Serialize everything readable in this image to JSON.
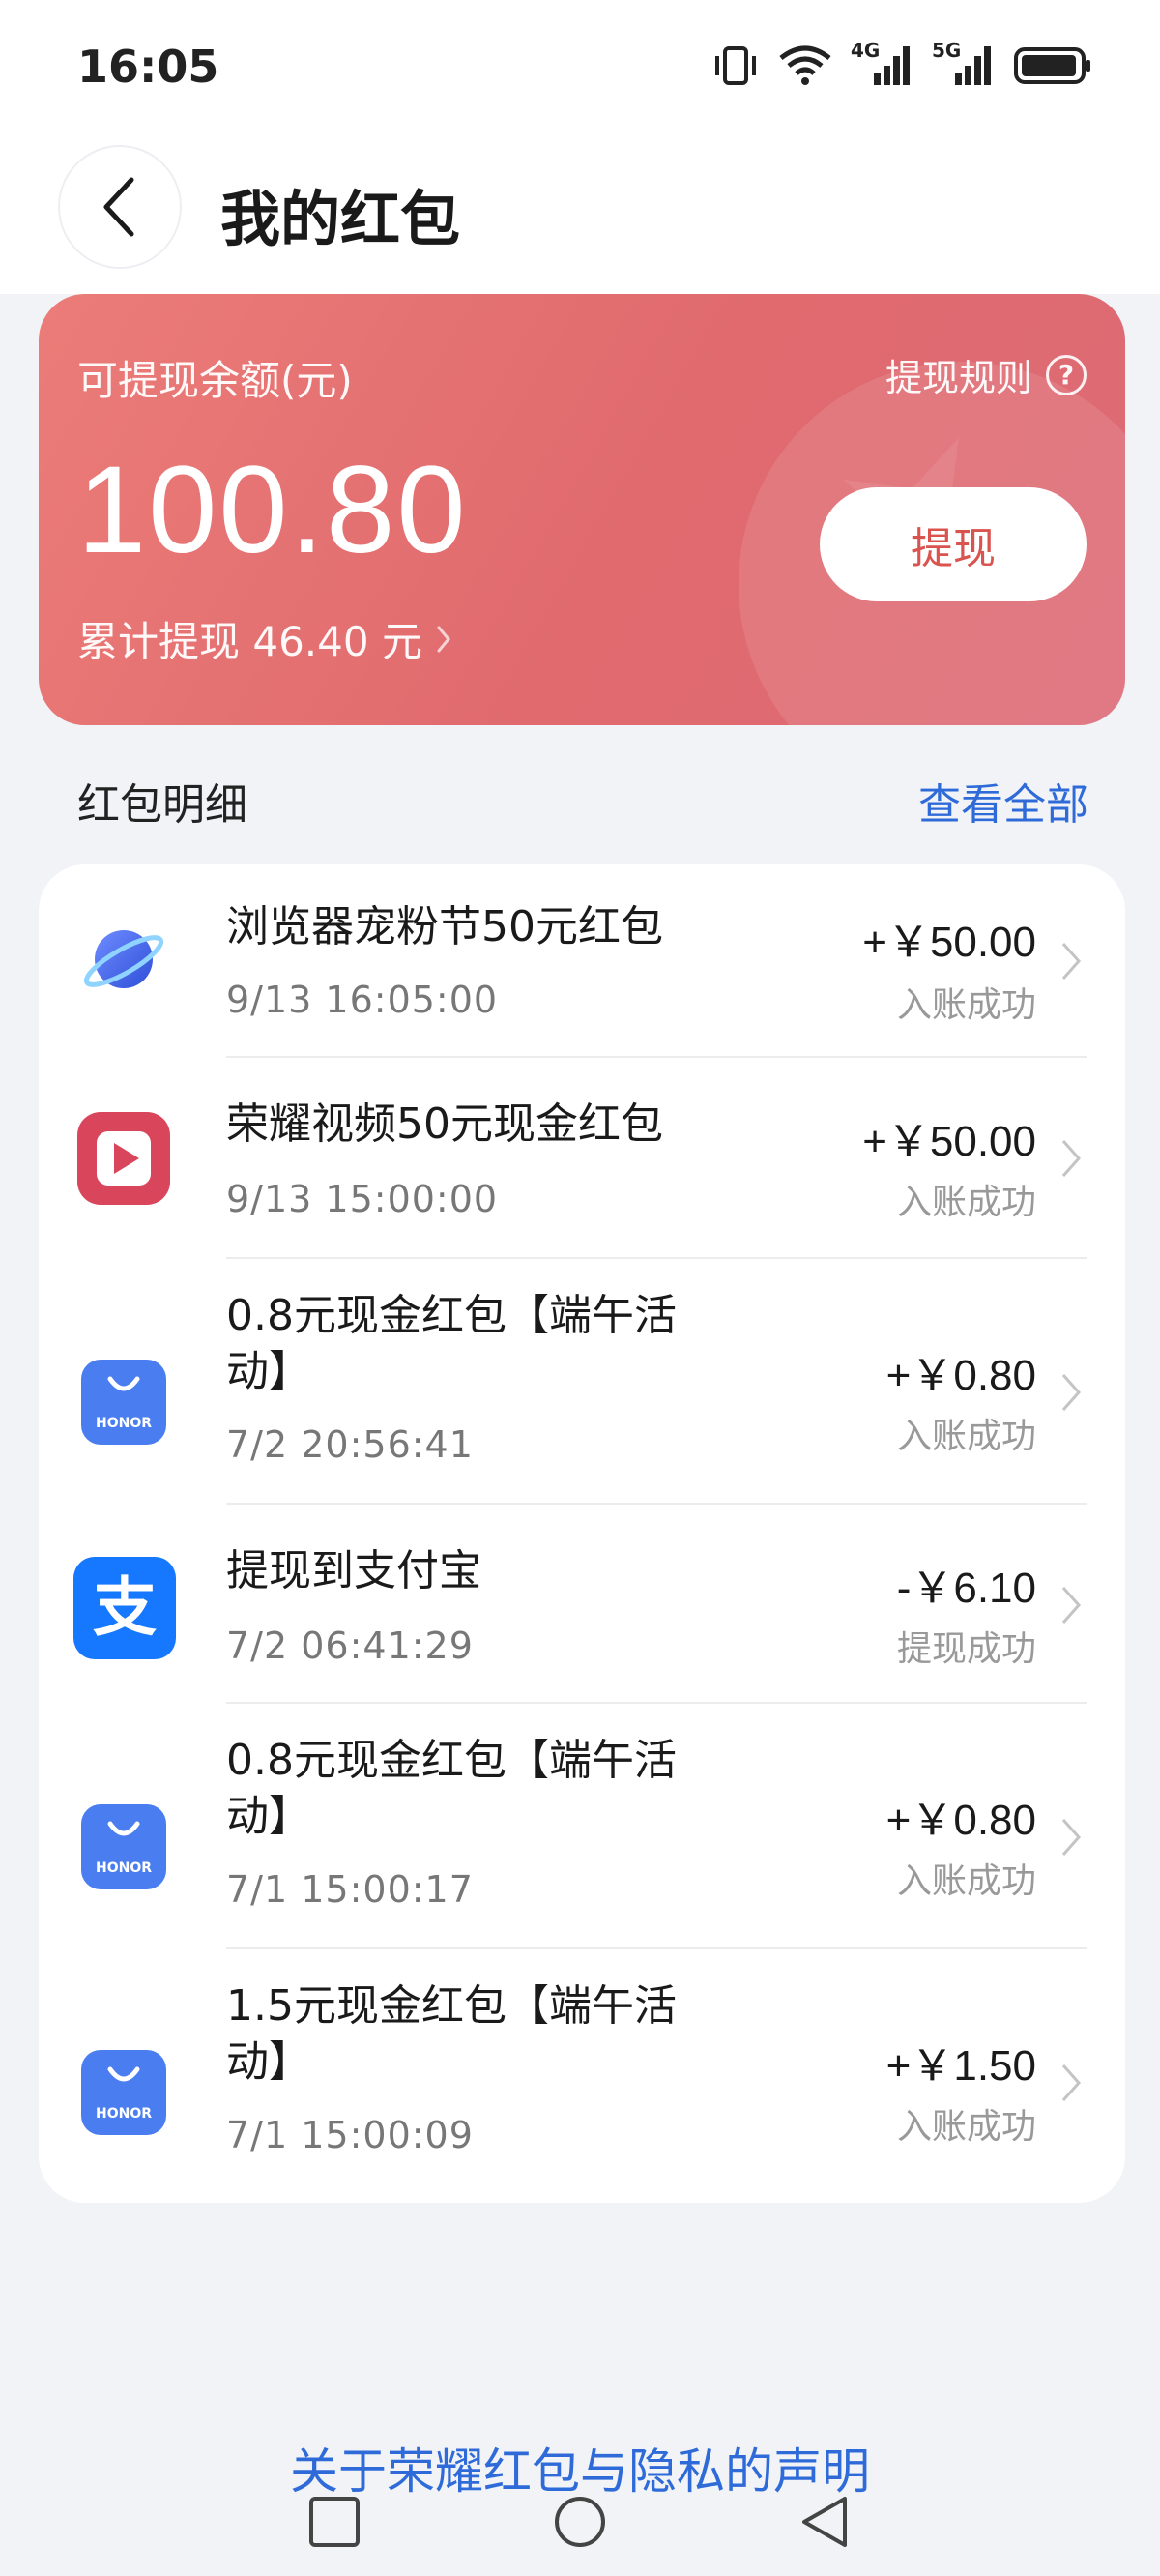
{
  "status_bar": {
    "time": "16:05",
    "network_labels": [
      "4G",
      "5G"
    ]
  },
  "header": {
    "title": "我的红包"
  },
  "balance_card": {
    "label": "可提现余额(元)",
    "rules_label": "提现规则",
    "rules_icon": "?",
    "amount": "100.80",
    "cumulative_text": "累计提现 46.40 元",
    "withdraw_label": "提现"
  },
  "section": {
    "title": "红包明细",
    "view_all": "查看全部"
  },
  "records": [
    {
      "icon": "browser-planet-icon",
      "title": "浏览器宠粉节50元红包",
      "date": "9/13 16:05:00",
      "amount": "+￥50.00",
      "status": "入账成功"
    },
    {
      "icon": "honor-video-icon",
      "title": "荣耀视频50元现金红包",
      "date": "9/13 15:00:00",
      "amount": "+￥50.00",
      "status": "入账成功"
    },
    {
      "icon": "honor-mall-icon",
      "title": "0.8元现金红包【端午活动】",
      "date": "7/2 20:56:41",
      "amount": "+￥0.80",
      "status": "入账成功"
    },
    {
      "icon": "alipay-icon",
      "title": "提现到支付宝",
      "date": "7/2 06:41:29",
      "amount": "-￥6.10",
      "status": "提现成功"
    },
    {
      "icon": "honor-mall-icon",
      "title": "0.8元现金红包【端午活动】",
      "date": "7/1 15:00:17",
      "amount": "+￥0.80",
      "status": "入账成功"
    },
    {
      "icon": "honor-mall-icon",
      "title": "1.5元现金红包【端午活动】",
      "date": "7/1 15:00:09",
      "amount": "+￥1.50",
      "status": "入账成功"
    }
  ],
  "honor_icon_text": "HONOR",
  "alipay_icon_text": "支",
  "footer": {
    "privacy_link": "关于荣耀红包与隐私的声明"
  },
  "colors": {
    "card_gradient_start": "#eb7c78",
    "card_gradient_end": "#dd6a76",
    "link_blue": "#2f6bd8",
    "honor_blue": "#4a7ef0",
    "alipay_blue": "#1677ff"
  }
}
